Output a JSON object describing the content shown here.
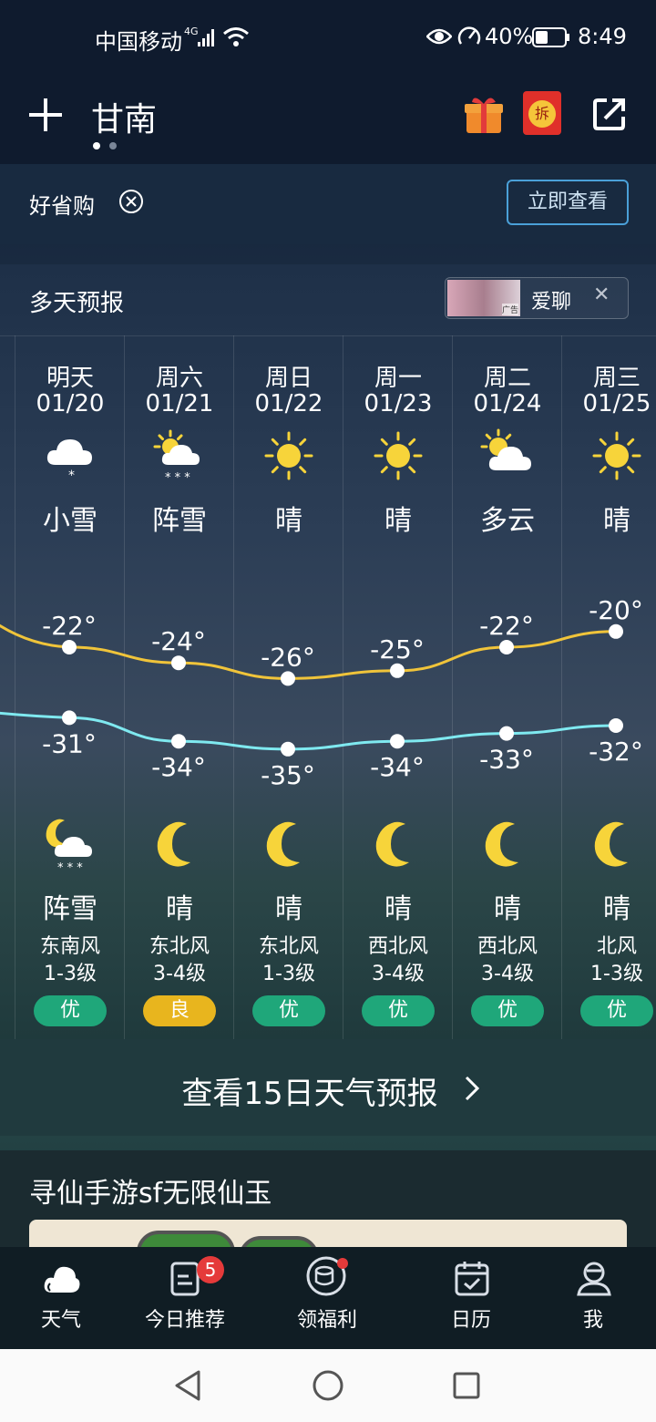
{
  "status": {
    "carrier": "中国移动",
    "net": "4G",
    "battery": "40%",
    "time": "8:49"
  },
  "header": {
    "city": "甘南",
    "red_packet": "拆"
  },
  "promo": {
    "label": "好省购",
    "button": "立即查看"
  },
  "forecast": {
    "title": "多天预报",
    "ad_label": "爱聊",
    "ad_tag": "广告",
    "days": [
      {
        "day": "明天",
        "date": "01/20",
        "cond": "小雪",
        "high": "-22°",
        "low": "-31°",
        "ncond": "阵雪",
        "wind": "东南风",
        "level": "1-3级",
        "aqi": "优",
        "icon": "snow-icon",
        "nicon": "moon-snow-icon"
      },
      {
        "day": "周六",
        "date": "01/21",
        "cond": "阵雪",
        "high": "-24°",
        "low": "-34°",
        "ncond": "晴",
        "wind": "东北风",
        "level": "3-4级",
        "aqi": "良",
        "icon": "sun-snow-icon",
        "nicon": "moon-icon"
      },
      {
        "day": "周日",
        "date": "01/22",
        "cond": "晴",
        "high": "-26°",
        "low": "-35°",
        "ncond": "晴",
        "wind": "东北风",
        "level": "1-3级",
        "aqi": "优",
        "icon": "sun-icon",
        "nicon": "moon-icon"
      },
      {
        "day": "周一",
        "date": "01/23",
        "cond": "晴",
        "high": "-25°",
        "low": "-34°",
        "ncond": "晴",
        "wind": "西北风",
        "level": "3-4级",
        "aqi": "优",
        "icon": "sun-icon",
        "nicon": "moon-icon"
      },
      {
        "day": "周二",
        "date": "01/24",
        "cond": "多云",
        "high": "-22°",
        "low": "-33°",
        "ncond": "晴",
        "wind": "西北风",
        "level": "3-4级",
        "aqi": "优",
        "icon": "partly-cloudy-icon",
        "nicon": "moon-icon"
      },
      {
        "day": "周三",
        "date": "01/25",
        "cond": "晴",
        "high": "-20°",
        "low": "-32°",
        "ncond": "晴",
        "wind": "北风",
        "level": "1-3级",
        "aqi": "优",
        "icon": "sun-icon",
        "nicon": "moon-icon"
      }
    ],
    "more": "查看15日天气预报"
  },
  "chart_data": {
    "type": "line",
    "categories": [
      "01/20",
      "01/21",
      "01/22",
      "01/23",
      "01/24",
      "01/25"
    ],
    "series": [
      {
        "values": [
          -22,
          -24,
          -26,
          -25,
          -22,
          -20
        ]
      },
      {
        "values": [
          -31,
          -34,
          -35,
          -34,
          -33,
          -32
        ]
      }
    ]
  },
  "ad": {
    "title": "寻仙手游sf无限仙玉"
  },
  "nav": {
    "weather": "天气",
    "today": "今日推荐",
    "today_badge": "5",
    "welfare": "领福利",
    "calendar": "日历",
    "me": "我"
  },
  "colors": {
    "high_line": "#f0c43a",
    "low_line": "#7fe9f0",
    "good": "#1fa77a",
    "moderate": "#e8b51e"
  }
}
